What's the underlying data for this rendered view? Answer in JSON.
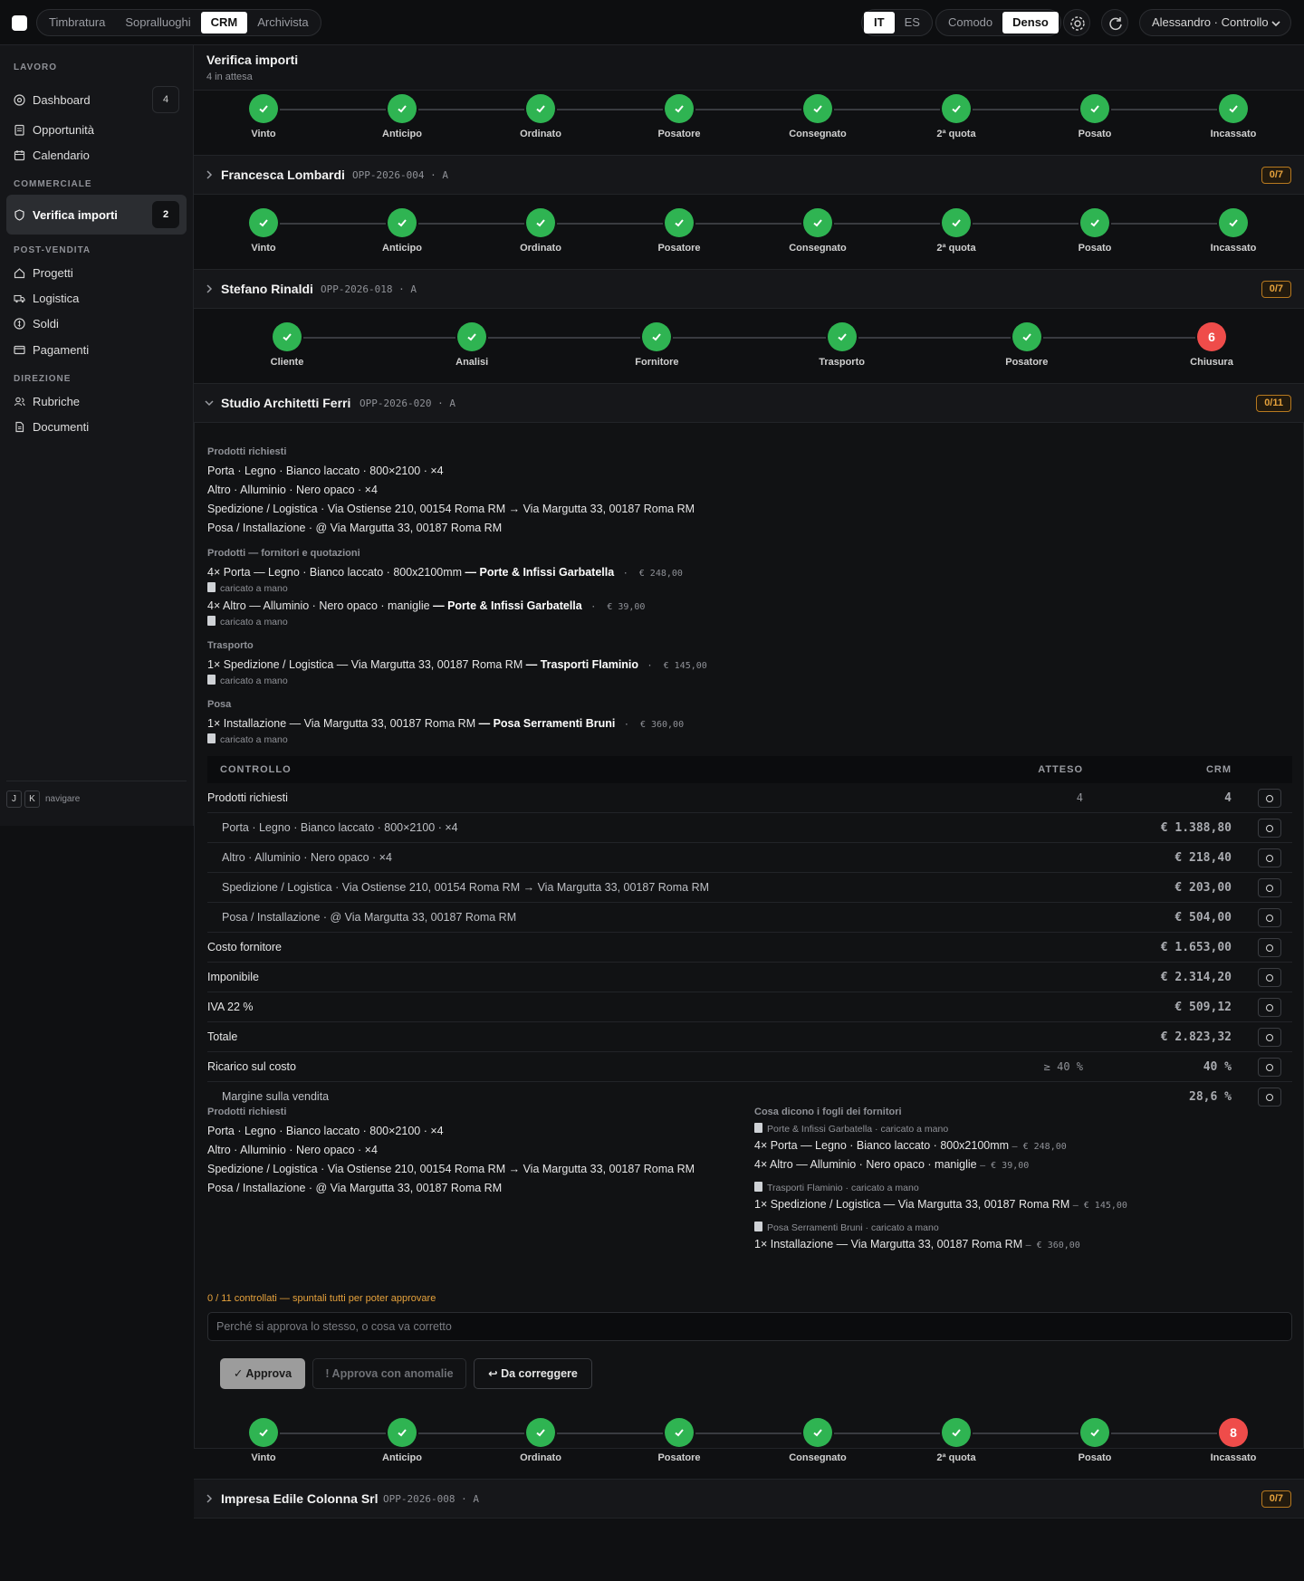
{
  "topbar": {
    "nav_tabs": [
      {
        "label": "Timbratura",
        "active": false
      },
      {
        "label": "Sopralluoghi",
        "active": false
      },
      {
        "label": "CRM",
        "active": true
      },
      {
        "label": "Archivista",
        "active": false
      }
    ],
    "languages": [
      {
        "label": "IT",
        "active": true
      },
      {
        "label": "ES",
        "active": false
      }
    ],
    "density": [
      {
        "label": "Comodo",
        "active": false
      },
      {
        "label": "Denso",
        "active": true
      }
    ],
    "user": "Alessandro · Controllo"
  },
  "sidebar": {
    "sections": [
      "LAVORO",
      "COMMERCIALE",
      "POST-VENDITA",
      "DIREZIONE"
    ],
    "items": [
      {
        "label": "Dashboard",
        "count": "4",
        "icon": "target-icon"
      },
      {
        "label": "Opportunità",
        "icon": "clipboard-icon"
      },
      {
        "label": "Calendario",
        "icon": "calendar-icon"
      },
      {
        "label": "Verifica importi",
        "count": "2",
        "icon": "shield-icon",
        "active": true
      },
      {
        "label": "Progetti",
        "icon": "home-icon"
      },
      {
        "label": "Logistica",
        "icon": "truck-icon"
      },
      {
        "label": "Soldi",
        "icon": "coin-icon"
      },
      {
        "label": "Pagamenti",
        "icon": "card-icon"
      },
      {
        "label": "Rubriche",
        "icon": "users-icon"
      },
      {
        "label": "Documenti",
        "icon": "file-icon"
      }
    ],
    "footer": {
      "keys": [
        "J",
        "K"
      ],
      "label": "navigare"
    }
  },
  "header": {
    "title": "Verifica importi",
    "subtitle": "4 in attesa"
  },
  "steps8": [
    "Vinto",
    "Anticipo",
    "Ordinato",
    "Posatore",
    "Consegnato",
    "2ª quota",
    "Posato",
    "Incassato"
  ],
  "steps6": [
    "Cliente",
    "Analisi",
    "Fornitore",
    "Trasporto",
    "Posatore",
    "Chiusura"
  ],
  "step_markers": {
    "chiusura": "6",
    "incassato": "8"
  },
  "opportunities": [
    {
      "name": "Francesca Lombardi",
      "code": "OPP-2026-004 · A",
      "badge": "0/7"
    },
    {
      "name": "Stefano Rinaldi",
      "code": "OPP-2026-018 · A",
      "badge": "0/7"
    },
    {
      "name": "Studio Architetti Ferri",
      "code": "OPP-2026-020 · A",
      "badge": "0/11"
    },
    {
      "name": "Impresa Edile Colonna Srl",
      "code": "OPP-2026-008 · A",
      "badge": "0/7"
    }
  ],
  "detail": {
    "requested_title": "Prodotti richiesti",
    "requested": [
      "Porta · Legno · Bianco laccato · 800×2100 · ×4",
      "Altro · Alluminio · Nero opaco · ×4",
      "Spedizione / Logistica · Via Ostiense 210, 00154 Roma RM → Via Margutta 33, 00187 Roma RM",
      "Posa / Installazione · @ Via Margutta 33, 00187 Roma RM"
    ],
    "manual": "caricato a mano",
    "suppliers_title": "Prodotti — fornitori e quotazioni",
    "suppliers": [
      {
        "text": "4× Porta — Legno · Bianco laccato · 800x2100mm",
        "vendor": "— Porte & Infissi Garbatella",
        "price": "€ 248,00"
      },
      {
        "text": "4× Altro — Alluminio · Nero opaco · maniglie",
        "vendor": "— Porte & Infissi Garbatella",
        "price": "€ 39,00"
      }
    ],
    "transport_title": "Trasporto",
    "transport": {
      "text": "1× Spedizione / Logistica — Via Margutta 33, 00187 Roma RM",
      "vendor": "— Trasporti Flaminio",
      "price": "€ 145,00"
    },
    "install_title": "Posa",
    "install": {
      "text": "1× Installazione — Via Margutta 33, 00187 Roma RM",
      "vendor": "— Posa Serramenti Bruni",
      "price": "€ 360,00"
    },
    "control_head": {
      "label": "CONTROLLO",
      "expected": "ATTESO",
      "crm": "CRM"
    },
    "control_rows": [
      {
        "label": "Prodotti richiesti",
        "expected": "4",
        "crm": "4",
        "indent": false
      },
      {
        "label": "Porta · Legno · Bianco laccato · 800×2100 · ×4",
        "expected": "",
        "crm": "€ 1.388,80",
        "indent": true
      },
      {
        "label": "Altro · Alluminio · Nero opaco · ×4",
        "expected": "",
        "crm": "€ 218,40",
        "indent": true
      },
      {
        "label": "Spedizione / Logistica · Via Ostiense 210, 00154 Roma RM → Via Margutta 33, 00187 Roma RM",
        "expected": "",
        "crm": "€ 203,00",
        "indent": true
      },
      {
        "label": "Posa / Installazione · @ Via Margutta 33, 00187 Roma RM",
        "expected": "",
        "crm": "€ 504,00",
        "indent": true
      },
      {
        "label": "Costo fornitore",
        "expected": "",
        "crm": "€ 1.653,00",
        "indent": false
      },
      {
        "label": "Imponibile",
        "expected": "",
        "crm": "€ 2.314,20",
        "indent": false
      },
      {
        "label": "IVA 22 %",
        "expected": "",
        "crm": "€ 509,12",
        "indent": false
      },
      {
        "label": "Totale",
        "expected": "",
        "crm": "€ 2.823,32",
        "indent": false
      },
      {
        "label": "Ricarico sul costo",
        "expected": "≥ 40 %",
        "crm": "40 %",
        "indent": false
      },
      {
        "label": "Margine sulla vendita",
        "expected": "",
        "crm": "28,6 %",
        "indent": true
      }
    ],
    "sheets_title": "Cosa dicono i fogli dei fornitori",
    "sheets": [
      {
        "source": "Porte & Infissi Garbatella · caricato a mano",
        "lines": [
          {
            "text": "4× Porta — Legno · Bianco laccato · 800x2100mm",
            "price": "— € 248,00"
          },
          {
            "text": "4× Altro — Alluminio · Nero opaco · maniglie",
            "price": "— € 39,00"
          }
        ]
      },
      {
        "source": "Trasporti Flaminio · caricato a mano",
        "lines": [
          {
            "text": "1× Spedizione / Logistica — Via Margutta 33, 00187 Roma RM",
            "price": "— € 145,00"
          }
        ]
      },
      {
        "source": "Posa Serramenti Bruni · caricato a mano",
        "lines": [
          {
            "text": "1× Installazione — Via Margutta 33, 00187 Roma RM",
            "price": "— € 360,00"
          }
        ]
      }
    ],
    "warning": "0 / 11 controllati — spuntali tutti per poter approvare",
    "reason_placeholder": "Perché si approva lo stesso, o cosa va corretto",
    "buttons": {
      "approve": "✓ Approva",
      "approve_anomalies": "! Approva con anomalie",
      "correct": "↩ Da correggere"
    }
  }
}
